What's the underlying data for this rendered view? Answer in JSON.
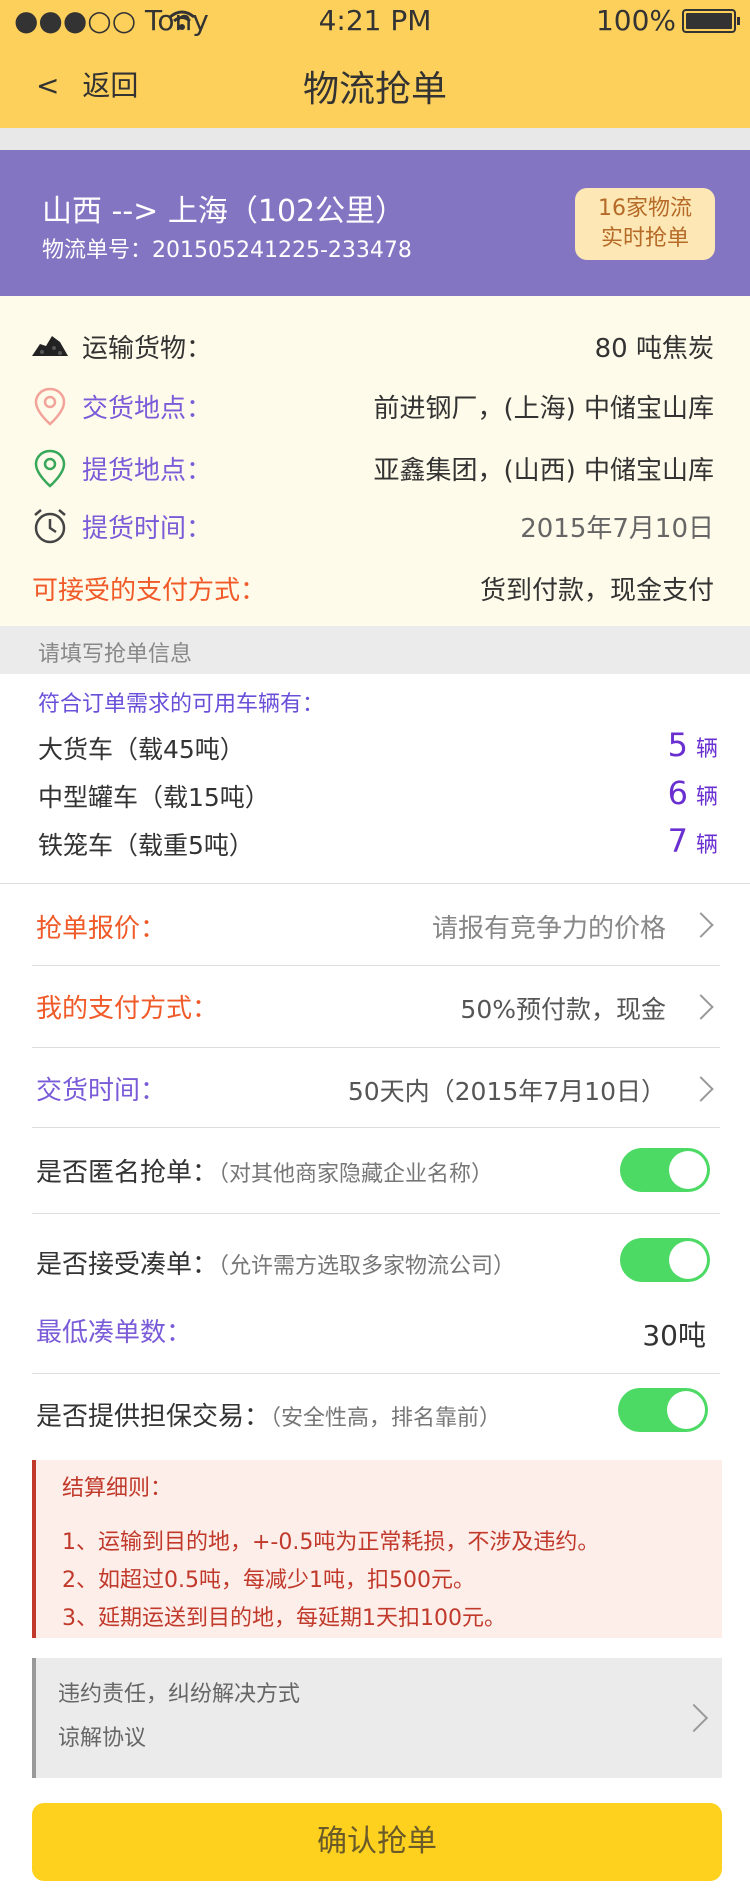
{
  "status": {
    "carrier": "●●●○○ Tony",
    "time": "4:21 PM",
    "battery": "100%"
  },
  "nav": {
    "back": "返回",
    "title": "物流抢单"
  },
  "route": {
    "line": "山西 --> 上海（102公里）",
    "order_no": "物流单号：201505241225-233478",
    "badge_line1": "16家物流",
    "badge_line2": "实时抢单"
  },
  "info": {
    "cargo": {
      "label": "运输货物：",
      "value": "80 吨焦炭"
    },
    "delivery": {
      "label": "交货地点：",
      "value": "前进钢厂，(上海) 中储宝山库"
    },
    "pickup": {
      "label": "提货地点：",
      "value": "亚鑫集团，(山西) 中储宝山库"
    },
    "pickup_time": {
      "label": "提货时间：",
      "value": "2015年7月10日"
    },
    "payment": {
      "label": "可接受的支付方式：",
      "value": "货到付款，现金支付"
    }
  },
  "section": {
    "title": "请填写抢单信息"
  },
  "vehicles": {
    "heading": "符合订单需求的可用车辆有：",
    "items": [
      {
        "name": "大货车（载45吨）",
        "count": "5",
        "unit": "辆"
      },
      {
        "name": "中型罐车（载15吨）",
        "count": "6",
        "unit": "辆"
      },
      {
        "name": "铁笼车（载重5吨）",
        "count": "7",
        "unit": "辆"
      }
    ]
  },
  "form": {
    "quote": {
      "label": "抢单报价：",
      "placeholder": "请报有竞争力的价格"
    },
    "pay": {
      "label": "我的支付方式：",
      "value": "50%预付款，现金"
    },
    "time": {
      "label": "交货时间：",
      "value": "50天内（2015年7月10日）"
    },
    "anon": {
      "label": "是否匿名抢单：",
      "note": "（对其他商家隐藏企业名称）",
      "on": true
    },
    "combine": {
      "label": "是否接受凑单：",
      "note": "（允许需方选取多家物流公司）",
      "on": true
    },
    "min": {
      "label": "最低凑单数：",
      "value": "30吨"
    },
    "guarantee": {
      "label": "是否提供担保交易：",
      "note": "（安全性高，排名靠前）",
      "on": true
    }
  },
  "rules": {
    "title": "结算细则：",
    "lines": [
      "1、运输到目的地，+-0.5吨为正常耗损，不涉及违约。",
      "2、如超过0.5吨，每减少1吨，扣500元。",
      "3、延期运送到目的地，每延期1天扣100元。"
    ]
  },
  "terms": {
    "line1": "违约责任，纠纷解决方式",
    "line2": "谅解协议"
  },
  "confirm": {
    "label": "确认抢单"
  },
  "colors": {
    "header": "#fdd05c",
    "route_bg": "#8475c3",
    "accent_purple": "#6a50d9",
    "accent_orange": "#f05a28",
    "toggle": "#4cd964",
    "confirm": "#fdd11d"
  }
}
